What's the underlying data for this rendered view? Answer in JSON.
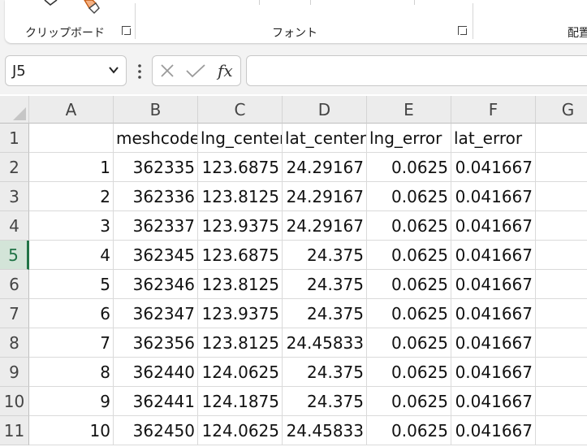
{
  "ribbon": {
    "groups": [
      {
        "label": "クリップボード"
      },
      {
        "label": "フォント"
      },
      {
        "label": "配置"
      }
    ]
  },
  "formula_bar": {
    "name_box": "J5",
    "formula": ""
  },
  "icons": [
    "format-painter-icon",
    "chevron-down-icon",
    "more-options-icon",
    "cancel-icon",
    "enter-icon",
    "function-icon",
    "dialog-launcher-icon"
  ],
  "grid": {
    "columns": [
      "A",
      "B",
      "C",
      "D",
      "E",
      "F",
      "G"
    ],
    "rows": [
      "1",
      "2",
      "3",
      "4",
      "5",
      "6",
      "7",
      "8",
      "9",
      "10",
      "11"
    ],
    "active_row": "5",
    "cells": [
      [
        "",
        "meshcode",
        "lng_center",
        "lat_center",
        "lng_error",
        "lat_error",
        ""
      ],
      [
        "1",
        "362335",
        "123.6875",
        "24.29167",
        "0.0625",
        "0.041667",
        ""
      ],
      [
        "2",
        "362336",
        "123.8125",
        "24.29167",
        "0.0625",
        "0.041667",
        ""
      ],
      [
        "3",
        "362337",
        "123.9375",
        "24.29167",
        "0.0625",
        "0.041667",
        ""
      ],
      [
        "4",
        "362345",
        "123.6875",
        "24.375",
        "0.0625",
        "0.041667",
        ""
      ],
      [
        "5",
        "362346",
        "123.8125",
        "24.375",
        "0.0625",
        "0.041667",
        ""
      ],
      [
        "6",
        "362347",
        "123.9375",
        "24.375",
        "0.0625",
        "0.041667",
        ""
      ],
      [
        "7",
        "362356",
        "123.8125",
        "24.45833",
        "0.0625",
        "0.041667",
        ""
      ],
      [
        "8",
        "362440",
        "124.0625",
        "24.375",
        "0.0625",
        "0.041667",
        ""
      ],
      [
        "9",
        "362441",
        "124.1875",
        "24.375",
        "0.0625",
        "0.041667",
        ""
      ],
      [
        "10",
        "362450",
        "124.0625",
        "24.45833",
        "0.0625",
        "0.041667",
        ""
      ]
    ]
  },
  "colors": {
    "accent": "#217346",
    "header_bg": "#ececec",
    "gridline": "#dadada"
  }
}
